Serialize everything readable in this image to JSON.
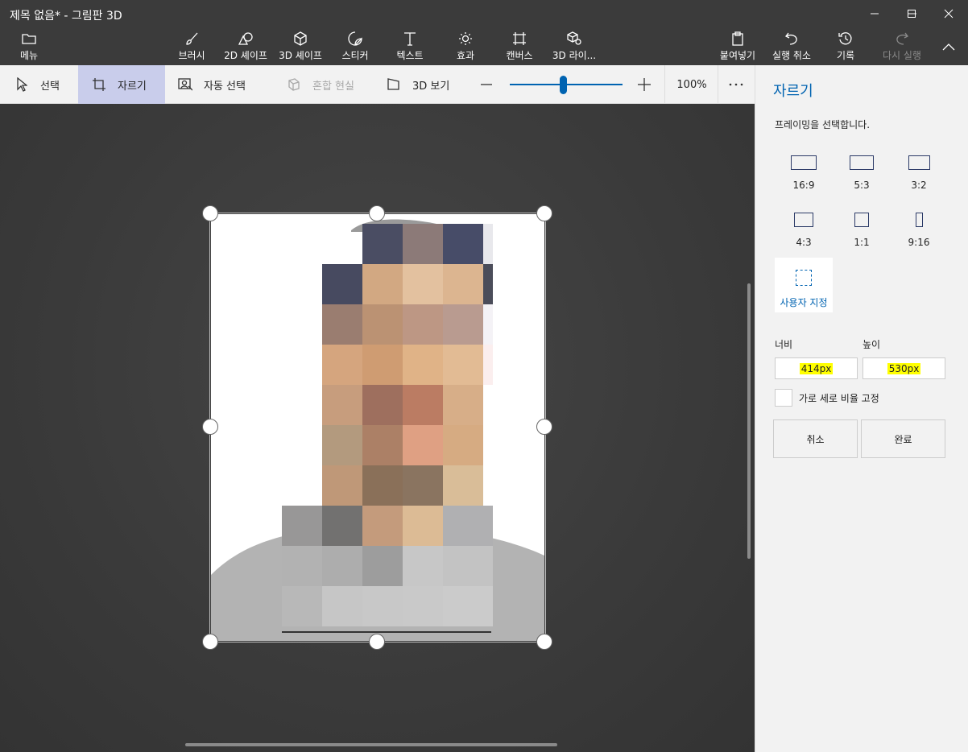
{
  "window": {
    "title": "제목 없음* - 그림판 3D"
  },
  "ribbon": {
    "menu": "메뉴",
    "brush": "브러시",
    "shapes2d": "2D 셰이프",
    "shapes3d": "3D 셰이프",
    "stickers": "스티커",
    "text": "텍스트",
    "effects": "효과",
    "canvas": "캔버스",
    "library3d": "3D 라이...",
    "paste": "붙여넣기",
    "undo": "실행 취소",
    "history": "기록",
    "redo": "다시 실행"
  },
  "toolbar": {
    "select": "선택",
    "crop": "자르기",
    "magic_select": "자동 선택",
    "mixed_reality": "혼합 현실",
    "view3d": "3D 보기",
    "zoom_level": "100%",
    "zoom_fraction": 0.47
  },
  "panel": {
    "title": "자르기",
    "subtitle": "프레이밍을 선택합니다.",
    "ratios": [
      "16:9",
      "5:3",
      "3:2",
      "4:3",
      "1:1",
      "9:16"
    ],
    "custom": "사용자 지정",
    "width_label": "너비",
    "height_label": "높이",
    "width_value": "414px",
    "height_value": "530px",
    "lock_label": "가로 세로 비율 고정",
    "lock_checked": false,
    "cancel": "취소",
    "done": "완료"
  },
  "colors": {
    "accent": "#0063b1",
    "crop_active": "#c9cdeb",
    "highlight": "#ffff00"
  }
}
